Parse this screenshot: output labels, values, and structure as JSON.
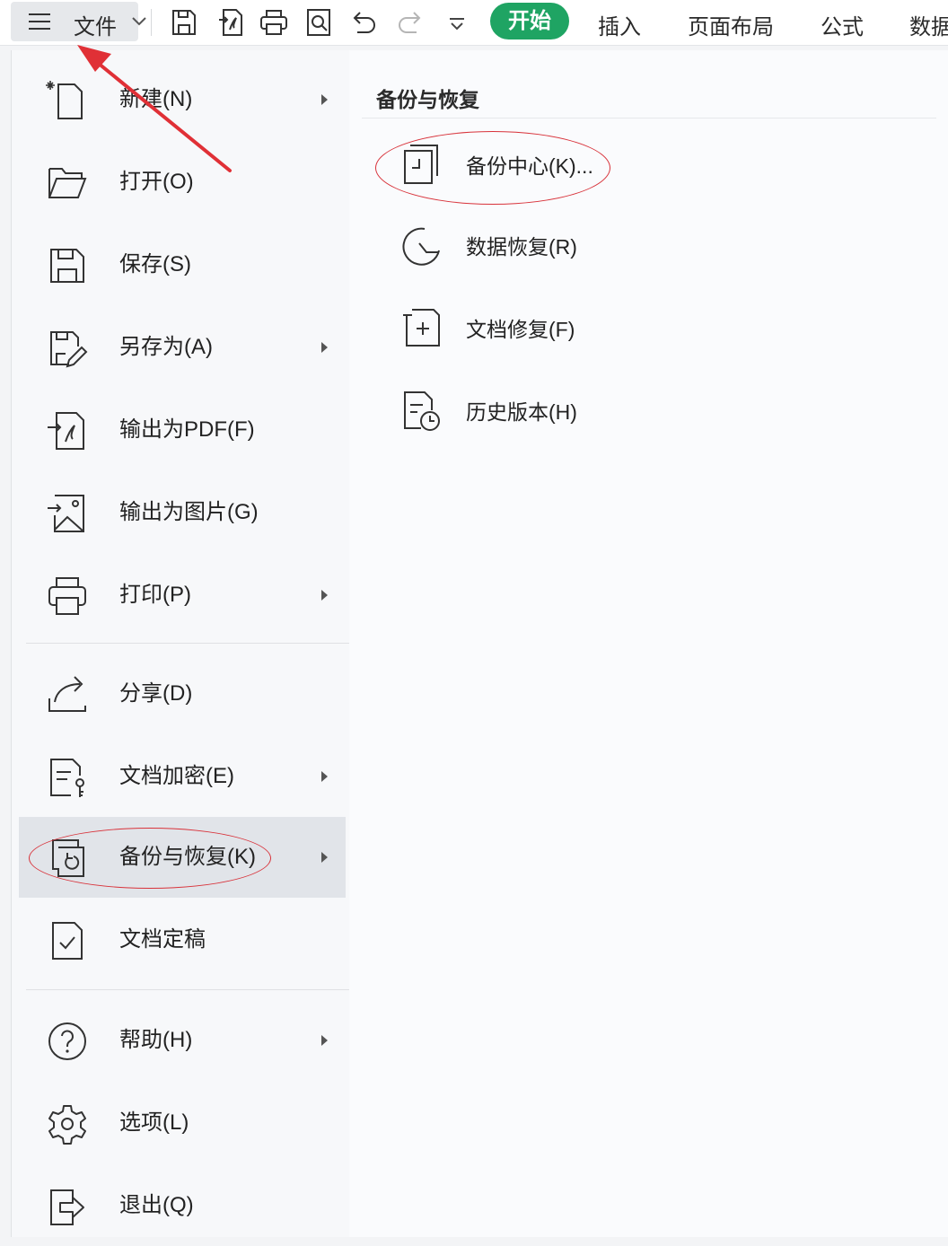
{
  "toolbar": {
    "file_label": "文件",
    "icons": [
      "menu-icon",
      "save-icon",
      "export-pdf-icon",
      "print-icon",
      "print-preview-icon",
      "undo-icon",
      "redo-icon",
      "more-dropdown-icon"
    ],
    "tabs": {
      "home": "开始",
      "insert": "插入",
      "page_layout": "页面布局",
      "formula": "公式",
      "data": "数据"
    },
    "active_tab_color": "#1fa463"
  },
  "menu": {
    "items": [
      {
        "label": "新建(N)",
        "icon": "new-file-icon",
        "submenu": true
      },
      {
        "label": "打开(O)",
        "icon": "folder-open-icon",
        "submenu": false
      },
      {
        "label": "保存(S)",
        "icon": "save-icon",
        "submenu": false
      },
      {
        "label": "另存为(A)",
        "icon": "save-as-icon",
        "submenu": true
      },
      {
        "label": "输出为PDF(F)",
        "icon": "export-pdf-icon",
        "submenu": false
      },
      {
        "label": "输出为图片(G)",
        "icon": "export-image-icon",
        "submenu": false
      },
      {
        "label": "打印(P)",
        "icon": "print-icon",
        "submenu": true
      },
      {
        "label": "分享(D)",
        "icon": "share-icon",
        "submenu": false
      },
      {
        "label": "文档加密(E)",
        "icon": "encrypt-doc-icon",
        "submenu": true
      },
      {
        "label": "备份与恢复(K)",
        "icon": "backup-restore-icon",
        "submenu": true,
        "selected": true
      },
      {
        "label": "文档定稿",
        "icon": "finalize-doc-icon",
        "submenu": false
      },
      {
        "label": "帮助(H)",
        "icon": "help-icon",
        "submenu": true
      },
      {
        "label": "选项(L)",
        "icon": "settings-gear-icon",
        "submenu": false
      },
      {
        "label": "退出(Q)",
        "icon": "exit-icon",
        "submenu": false
      }
    ],
    "selected_color": "#e1e4e9"
  },
  "submenu": {
    "title": "备份与恢复",
    "items": [
      {
        "label": "备份中心(K)...",
        "icon": "backup-center-icon"
      },
      {
        "label": "数据恢复(R)",
        "icon": "data-recovery-icon"
      },
      {
        "label": "文档修复(F)",
        "icon": "doc-repair-icon"
      },
      {
        "label": "历史版本(H)",
        "icon": "history-version-icon"
      }
    ]
  },
  "annotation_color": "#d8323a"
}
